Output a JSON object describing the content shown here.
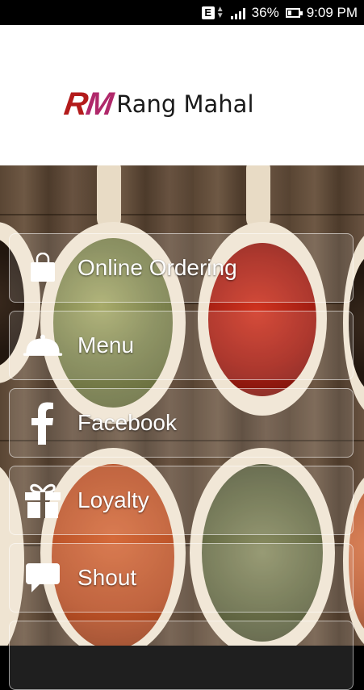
{
  "status_bar": {
    "network_type": "E",
    "battery_percent": "36%",
    "battery_level": 0.36,
    "time": "9:09 PM"
  },
  "header": {
    "logo_mark_r": "R",
    "logo_mark_m": "M",
    "brand_name": "Rang Mahal",
    "colors": {
      "r": "#b31b1b",
      "m": "#b0286a"
    }
  },
  "menu": {
    "items": [
      {
        "label": "Online Ordering",
        "icon": "shopping-bag-icon"
      },
      {
        "label": "Menu",
        "icon": "cloche-icon"
      },
      {
        "label": "Facebook",
        "icon": "facebook-icon"
      },
      {
        "label": "Loyalty",
        "icon": "gift-icon"
      },
      {
        "label": "Shout",
        "icon": "speech-bubble-icon"
      }
    ]
  }
}
